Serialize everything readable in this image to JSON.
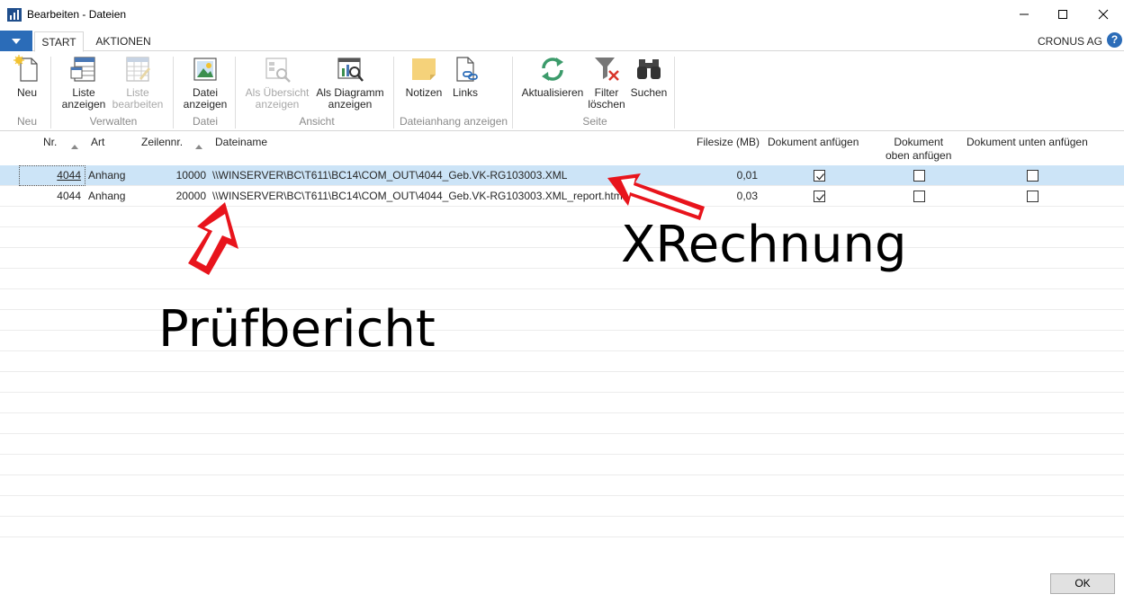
{
  "window": {
    "title": "Bearbeiten - Dateien",
    "icon": "app-icon",
    "controls": [
      "minimize-icon",
      "maximize-icon",
      "close-icon"
    ]
  },
  "tabs": [
    {
      "label": "START",
      "active": true
    },
    {
      "label": "AKTIONEN",
      "active": false
    }
  ],
  "company": "CRONUS AG",
  "help_label": "?",
  "ribbon": {
    "groups": [
      {
        "label": "Neu",
        "buttons": [
          {
            "label": "Neu",
            "icon": "new-document-icon",
            "enabled": true
          }
        ]
      },
      {
        "label": "Verwalten",
        "buttons": [
          {
            "label": "Liste anzeigen",
            "line1": "Liste",
            "line2": "anzeigen",
            "icon": "list-view-icon",
            "enabled": true
          },
          {
            "label": "Liste bearbeiten",
            "line1": "Liste",
            "line2": "bearbeiten",
            "icon": "list-edit-icon",
            "enabled": false
          }
        ]
      },
      {
        "label": "Datei",
        "buttons": [
          {
            "label": "Datei anzeigen",
            "line1": "Datei",
            "line2": "anzeigen",
            "icon": "image-file-icon",
            "enabled": true
          }
        ]
      },
      {
        "label": "Ansicht",
        "buttons": [
          {
            "label": "Als Übersicht anzeigen",
            "line1": "Als Übersicht",
            "line2": "anzeigen",
            "icon": "overview-icon",
            "enabled": false
          },
          {
            "label": "Als Diagramm anzeigen",
            "line1": "Als Diagramm",
            "line2": "anzeigen",
            "icon": "chart-icon",
            "enabled": true
          }
        ]
      },
      {
        "label": "Dateianhang anzeigen",
        "buttons": [
          {
            "label": "Notizen",
            "icon": "note-icon",
            "enabled": true
          },
          {
            "label": "Links",
            "icon": "link-icon",
            "enabled": true
          }
        ]
      },
      {
        "label": "Seite",
        "buttons": [
          {
            "label": "Aktualisieren",
            "icon": "refresh-icon",
            "enabled": true
          },
          {
            "label": "Filter löschen",
            "line1": "Filter",
            "line2": "löschen",
            "icon": "clear-filter-icon",
            "enabled": true
          },
          {
            "label": "Suchen",
            "icon": "binoculars-icon",
            "enabled": true
          }
        ]
      }
    ]
  },
  "table": {
    "columns": {
      "nr": "Nr.",
      "art": "Art",
      "zeilennr": "Zeilennr.",
      "dateiname": "Dateiname",
      "filesize": "Filesize (MB)",
      "dok_anfuegen": "Dokument anfügen",
      "dok_oben_1": "Dokument",
      "dok_oben_2": "oben anfügen",
      "dok_unten": "Dokument unten anfügen"
    },
    "rows": [
      {
        "nr": "4044",
        "art": "Anhang",
        "zeilennr": "10000",
        "dateiname": "\\\\WINSERVER\\BC\\T611\\BC14\\COM_OUT\\4044_Geb.VK-RG103003.XML",
        "filesize": "0,01",
        "dok_anfuegen": true,
        "dok_oben": false,
        "dok_unten": false,
        "selected": true
      },
      {
        "nr": "4044",
        "art": "Anhang",
        "zeilennr": "20000",
        "dateiname": "\\\\WINSERVER\\BC\\T611\\BC14\\COM_OUT\\4044_Geb.VK-RG103003.XML_report.html",
        "filesize": "0,03",
        "dok_anfuegen": true,
        "dok_oben": false,
        "dok_unten": false,
        "selected": false
      }
    ]
  },
  "annotations": {
    "xrechnung": "XRechnung",
    "pruefbericht": "Prüfbericht",
    "arrow_color": "#e8141c"
  },
  "footer": {
    "ok_label": "OK"
  }
}
